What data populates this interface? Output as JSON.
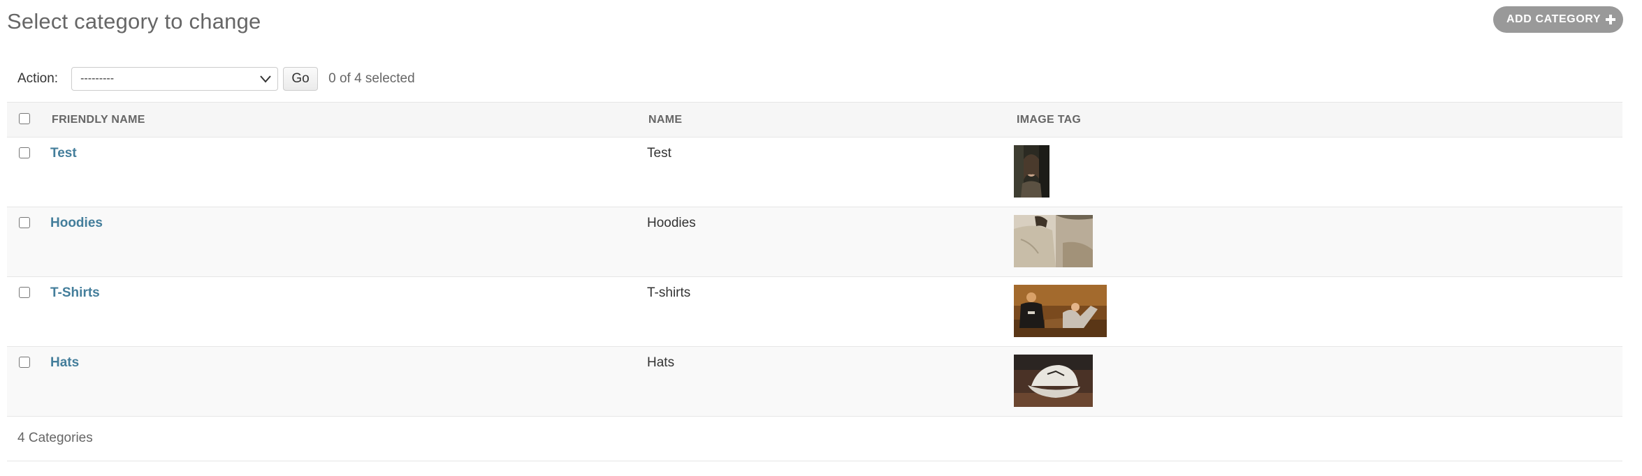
{
  "header": {
    "title": "Select category to change",
    "add_button_label": "ADD CATEGORY",
    "add_icon": "plus-icon"
  },
  "actions": {
    "label": "Action:",
    "selected_option": "---------",
    "go_label": "Go",
    "selected_count": "0 of 4 selected"
  },
  "table": {
    "columns": [
      "FRIENDLY NAME",
      "NAME",
      "IMAGE TAG"
    ],
    "rows": [
      {
        "friendly_name": "Test",
        "name": "Test",
        "image": "portrait of person in dark forest"
      },
      {
        "friendly_name": "Hoodies",
        "name": "Hoodies",
        "image": "person wearing beige hoodie outdoors"
      },
      {
        "friendly_name": "T-Shirts",
        "name": "T-shirts",
        "image": "people sitting in golden field wearing t-shirts"
      },
      {
        "friendly_name": "Hats",
        "name": "Hats",
        "image": "white baseball cap on wooden surface"
      }
    ]
  },
  "footer": {
    "count_text": "4 Categories"
  },
  "colors": {
    "link": "#447e9b",
    "add_button_bg": "#999999",
    "header_bg": "#f6f6f6",
    "row_alt_bg": "#f9f9f9"
  }
}
